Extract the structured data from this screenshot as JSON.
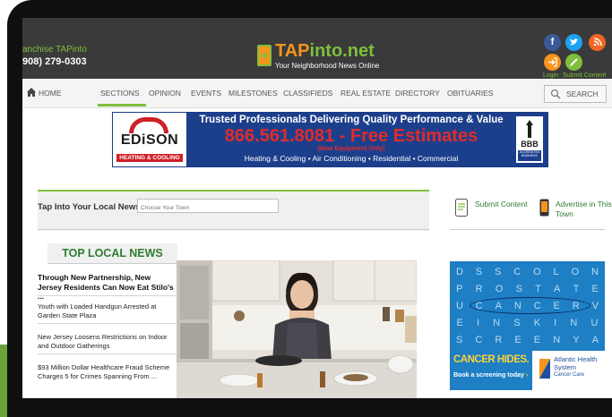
{
  "header": {
    "franchise_text": "anchise TAPinto",
    "phone": "908) 279-0303",
    "logo_tap": "TAP",
    "logo_into": "into",
    "logo_net": ".net",
    "tagline": "Your Neighborhood News Online",
    "login_label": "Login",
    "submit_content_label": "Submit Content",
    "social_facebook": "f",
    "social_twitter": "t",
    "social_rss": "r"
  },
  "nav": {
    "items": [
      "HOME",
      "SECTIONS",
      "OPINION",
      "EVENTS",
      "MILESTONES",
      "CLASSIFIEDS",
      "REAL ESTATE",
      "DIRECTORY",
      "OBITUARIES"
    ],
    "search_label": "SEARCH",
    "active_item": "SECTIONS"
  },
  "ad": {
    "brand": "EDiSON",
    "brand_sub": "HEATING & COOLING",
    "headline": "Trusted Professionals Delivering Quality Performance & Value",
    "phone": "866.561.8081 - Free Estimates",
    "note": "(New Equipment Only)",
    "services": "Heating & Cooling • Air Conditioning • Residential • Commercial",
    "bbb": "BBB",
    "bbb_sub": "ACCREDITED BUSINESS"
  },
  "local_news": {
    "label": "Tap Into Your Local News:",
    "town_placeholder": "Choose Your Town"
  },
  "sidebar": {
    "submit_label": "Submit Content",
    "advertise_label": "Advertise in This Town"
  },
  "top_news": {
    "title": "TOP LOCAL NEWS",
    "items": [
      "Through New Partnership, New Jersey Residents Can Now Eat Stilo's ...",
      "Youth with Loaded Handgun Arrested at Garden State Plaza",
      "New Jersey Loosens Restrictions on Indoor and Outdoor Gatherings",
      "$93 Million Dollar Healthcare Fraud Scheme Charges 5 for Crimes Spanning From ..."
    ]
  },
  "word_search": {
    "rows": [
      [
        "D",
        "S",
        "S",
        "C",
        "O",
        "L",
        "O",
        "N"
      ],
      [
        "P",
        "R",
        "O",
        "S",
        "T",
        "A",
        "T",
        "E"
      ],
      [
        "U",
        "C",
        "A",
        "N",
        "C",
        "E",
        "R",
        "V"
      ],
      [
        "E",
        "I",
        "N",
        "S",
        "K",
        "I",
        "N",
        "U"
      ],
      [
        "S",
        "C",
        "R",
        "E",
        "E",
        "N",
        "Y",
        "A"
      ]
    ]
  },
  "cancer_ad": {
    "headline": "CANCER HIDES.",
    "cta": "Book a screening today",
    "arrow": "›",
    "org": "Atlantic Health System",
    "org_sub": "Cancer Care"
  },
  "colors": {
    "header_bg": "#3a3a3a",
    "accent_green": "#7fbf3b",
    "accent_orange": "#f7941d",
    "news_green": "#2e7d32",
    "ad_blue": "#1c3f8c",
    "ad_red": "#e02b2b"
  }
}
